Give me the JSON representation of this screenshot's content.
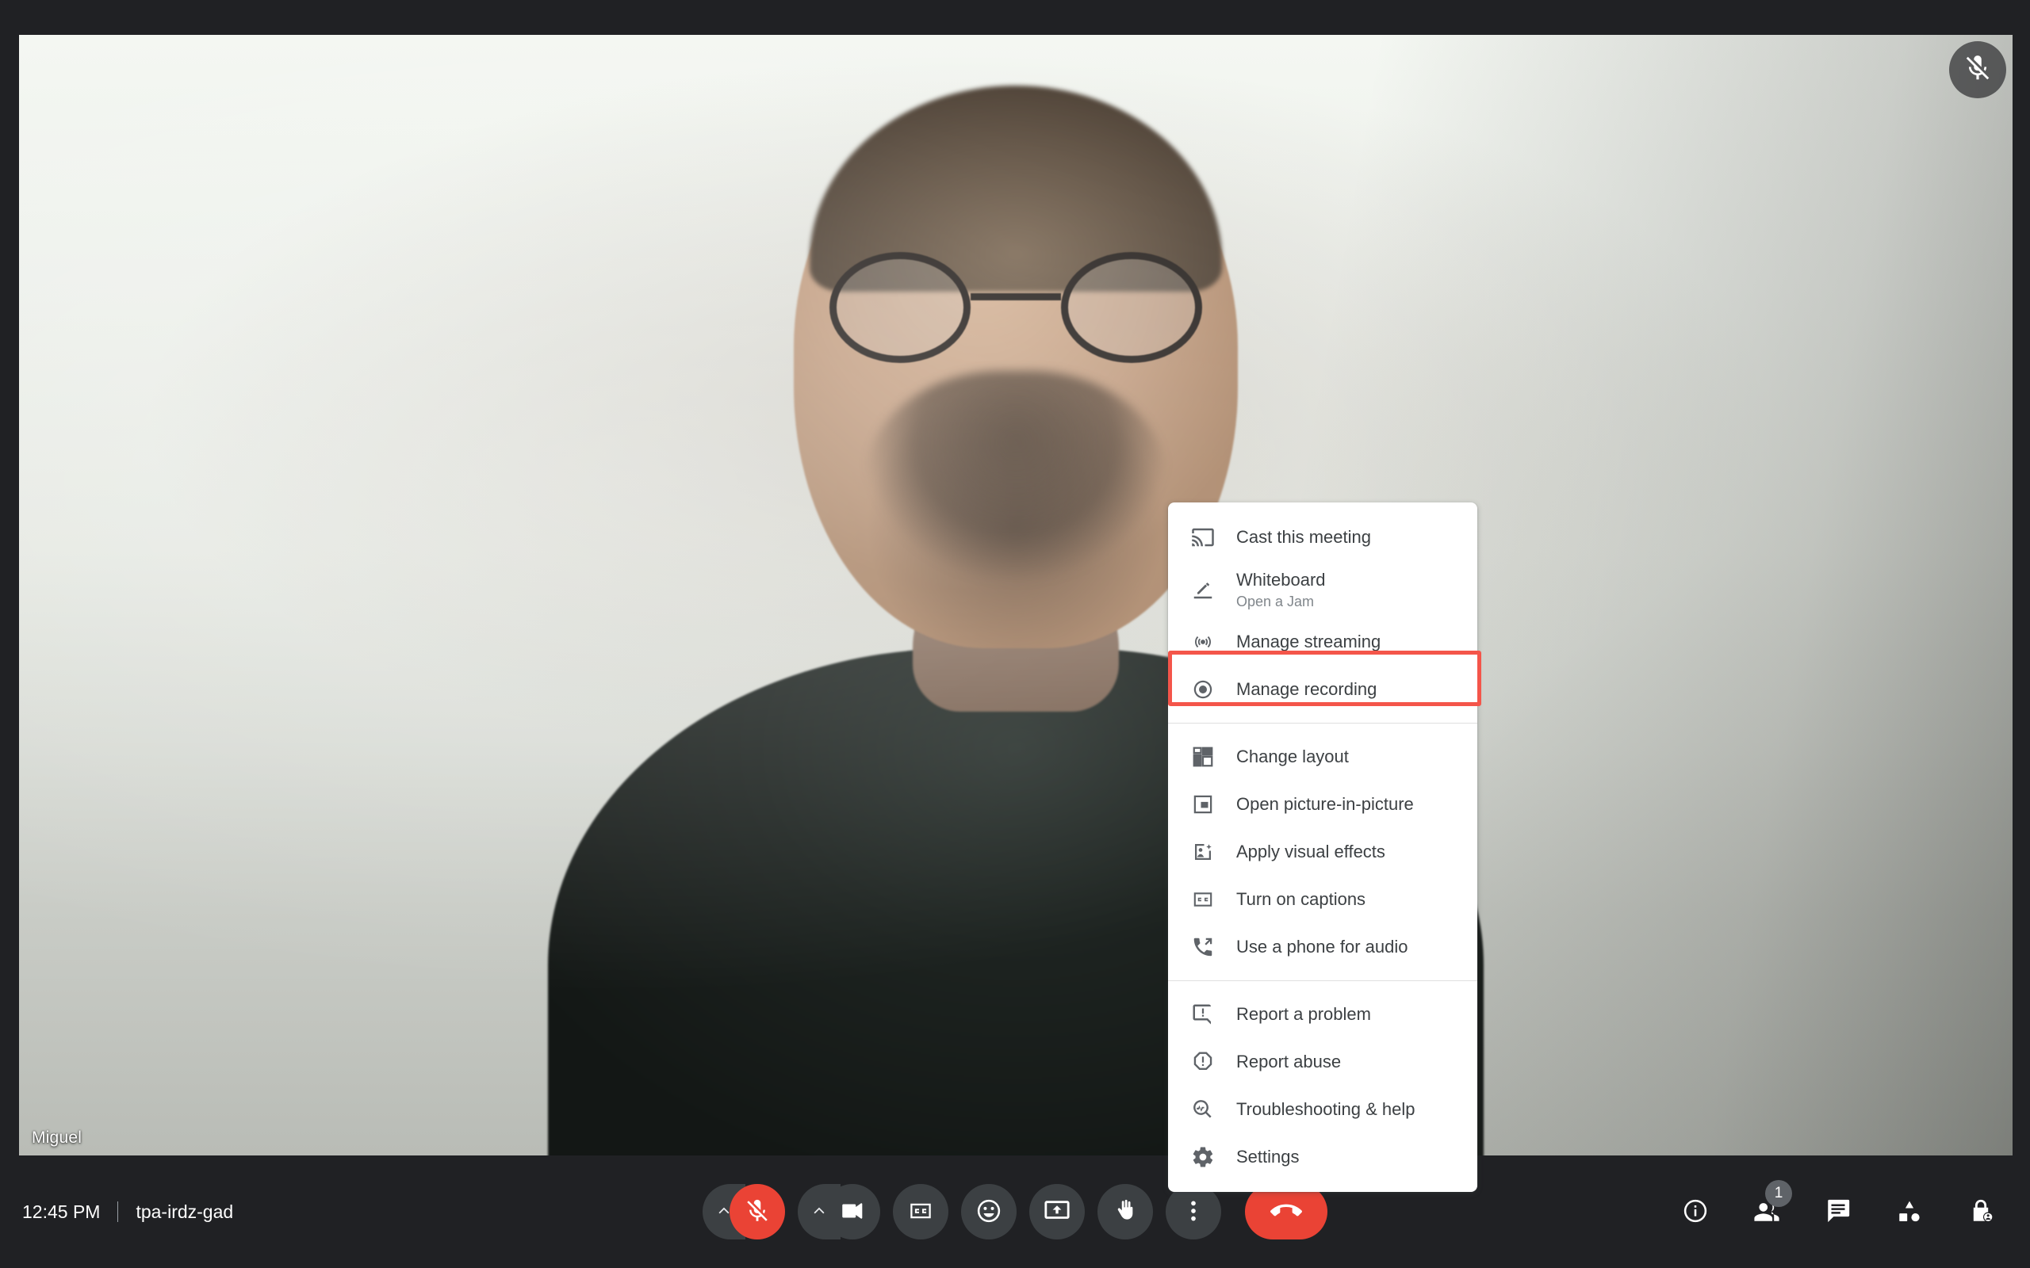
{
  "app": {
    "title": "Google Meet",
    "background_color": "#202124",
    "accent_red": "#ea4335",
    "highlight_color": "#f4554a"
  },
  "video_tile": {
    "participant_name": "Miguel",
    "mic_status_icon": "mic-off-icon",
    "mic_muted": "true"
  },
  "overflow_menu": {
    "groups": [
      {
        "items": [
          {
            "icon": "cast-icon",
            "label": "Cast this meeting",
            "sub": ""
          },
          {
            "icon": "whiteboard-pen-icon",
            "label": "Whiteboard",
            "sub": "Open a Jam"
          },
          {
            "icon": "manage-streaming-icon",
            "label": "Manage streaming",
            "sub": ""
          },
          {
            "icon": "manage-recording-icon",
            "label": "Manage recording",
            "sub": "",
            "highlighted": "true"
          }
        ]
      },
      {
        "items": [
          {
            "icon": "change-layout-icon",
            "label": "Change layout",
            "sub": ""
          },
          {
            "icon": "picture-in-picture-icon",
            "label": "Open picture-in-picture",
            "sub": ""
          },
          {
            "icon": "visual-effects-icon",
            "label": "Apply visual effects",
            "sub": ""
          },
          {
            "icon": "closed-captions-icon",
            "label": "Turn on captions",
            "sub": ""
          },
          {
            "icon": "phone-audio-icon",
            "label": "Use a phone for audio",
            "sub": ""
          }
        ]
      },
      {
        "items": [
          {
            "icon": "report-problem-icon",
            "label": "Report a problem",
            "sub": ""
          },
          {
            "icon": "report-abuse-icon",
            "label": "Report abuse",
            "sub": ""
          },
          {
            "icon": "troubleshooting-icon",
            "label": "Troubleshooting & help",
            "sub": ""
          },
          {
            "icon": "settings-gear-icon",
            "label": "Settings",
            "sub": ""
          }
        ]
      }
    ]
  },
  "bottom_bar": {
    "time": "12:45 PM",
    "meeting_code": "tpa-irdz-gad",
    "center_controls": [
      {
        "name": "mic-options",
        "icon": "chevron-up-icon",
        "label": "Microphone options"
      },
      {
        "name": "mic-toggle",
        "icon": "mic-off-icon",
        "label": "Turn on microphone",
        "state": "muted"
      },
      {
        "name": "camera-options",
        "icon": "chevron-up-icon",
        "label": "Camera options"
      },
      {
        "name": "camera-toggle",
        "icon": "video-camera-icon",
        "label": "Turn off camera",
        "state": "on"
      },
      {
        "name": "captions-toggle",
        "icon": "closed-captions-icon",
        "label": "Turn on captions"
      },
      {
        "name": "reactions",
        "icon": "emoji-smile-icon",
        "label": "Send a reaction"
      },
      {
        "name": "present-now",
        "icon": "present-screen-icon",
        "label": "Present now"
      },
      {
        "name": "raise-hand",
        "icon": "raised-hand-icon",
        "label": "Raise hand"
      },
      {
        "name": "more-options",
        "icon": "more-vertical-icon",
        "label": "More options",
        "state": "active"
      },
      {
        "name": "leave-call",
        "icon": "hangup-phone-icon",
        "label": "Leave call"
      }
    ],
    "right_controls": [
      {
        "name": "meeting-details",
        "icon": "info-circle-icon",
        "label": "Meeting details",
        "badge": ""
      },
      {
        "name": "show-everyone",
        "icon": "people-icon",
        "label": "Show everyone",
        "badge": "1"
      },
      {
        "name": "chat",
        "icon": "chat-bubble-icon",
        "label": "Chat with everyone",
        "badge": ""
      },
      {
        "name": "activities",
        "icon": "activities-shapes-icon",
        "label": "Activities",
        "badge": ""
      },
      {
        "name": "host-controls",
        "icon": "host-lock-icon",
        "label": "Host controls",
        "badge": ""
      }
    ]
  }
}
